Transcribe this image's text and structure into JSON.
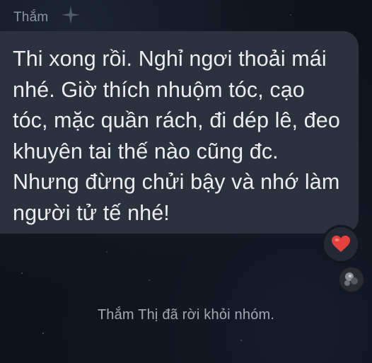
{
  "message": {
    "sender_name": "Thắm",
    "text": "Thi xong rồi. Nghỉ ngơi thoải mái nhé. Giờ thích nhuộm tóc, cạo tóc, mặc quần rách, đi dép lê, đeo khuyên tai thế nào cũng đc. Nhưng đừng chửi bậy và nhớ làm người tử tế nhé!",
    "reaction": "heart-emoji",
    "bubble_color": "#2b313d"
  },
  "seen_indicator": {
    "avatar": "user-avatar"
  },
  "system_message": {
    "text": "Thắm Thị đã rời khỏi nhóm."
  },
  "theme": {
    "background": "#0e121b",
    "text_color": "#ecedf0",
    "meta_text_color": "#8d94a3",
    "heart_color": "#e8423f"
  }
}
